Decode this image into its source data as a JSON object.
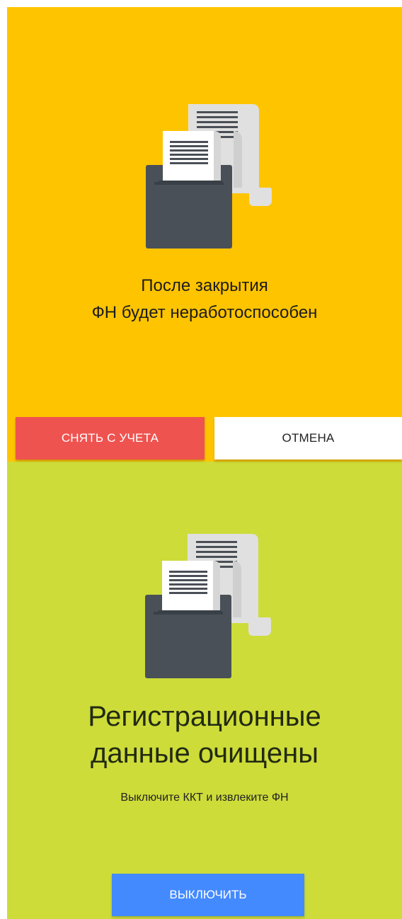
{
  "deregister_screen": {
    "message_line1": "После закрытия",
    "message_line2": "ФН будет неработоспособен",
    "deregister_button": "СНЯТЬ С УЧЕТА",
    "cancel_button": "ОТМЕНА",
    "background_color": "#ffc400",
    "illustration_icon": "receipt-printer-icon"
  },
  "cleared_screen": {
    "title_line1": "Регистрационные",
    "title_line2": "данные очищены",
    "subtitle": "Выключите ККТ и извлеките ФН",
    "poweroff_button": "ВЫКЛЮЧИТЬ",
    "background_color": "#cddc39",
    "illustration_icon": "receipt-printer-icon"
  },
  "colors": {
    "deregister_button": "#ef5350",
    "cancel_button": "#ffffff",
    "poweroff_button": "#448aff",
    "printer_body": "#495058",
    "receipt_back": "#e0e0e0",
    "receipt_front": "#ffffff"
  }
}
